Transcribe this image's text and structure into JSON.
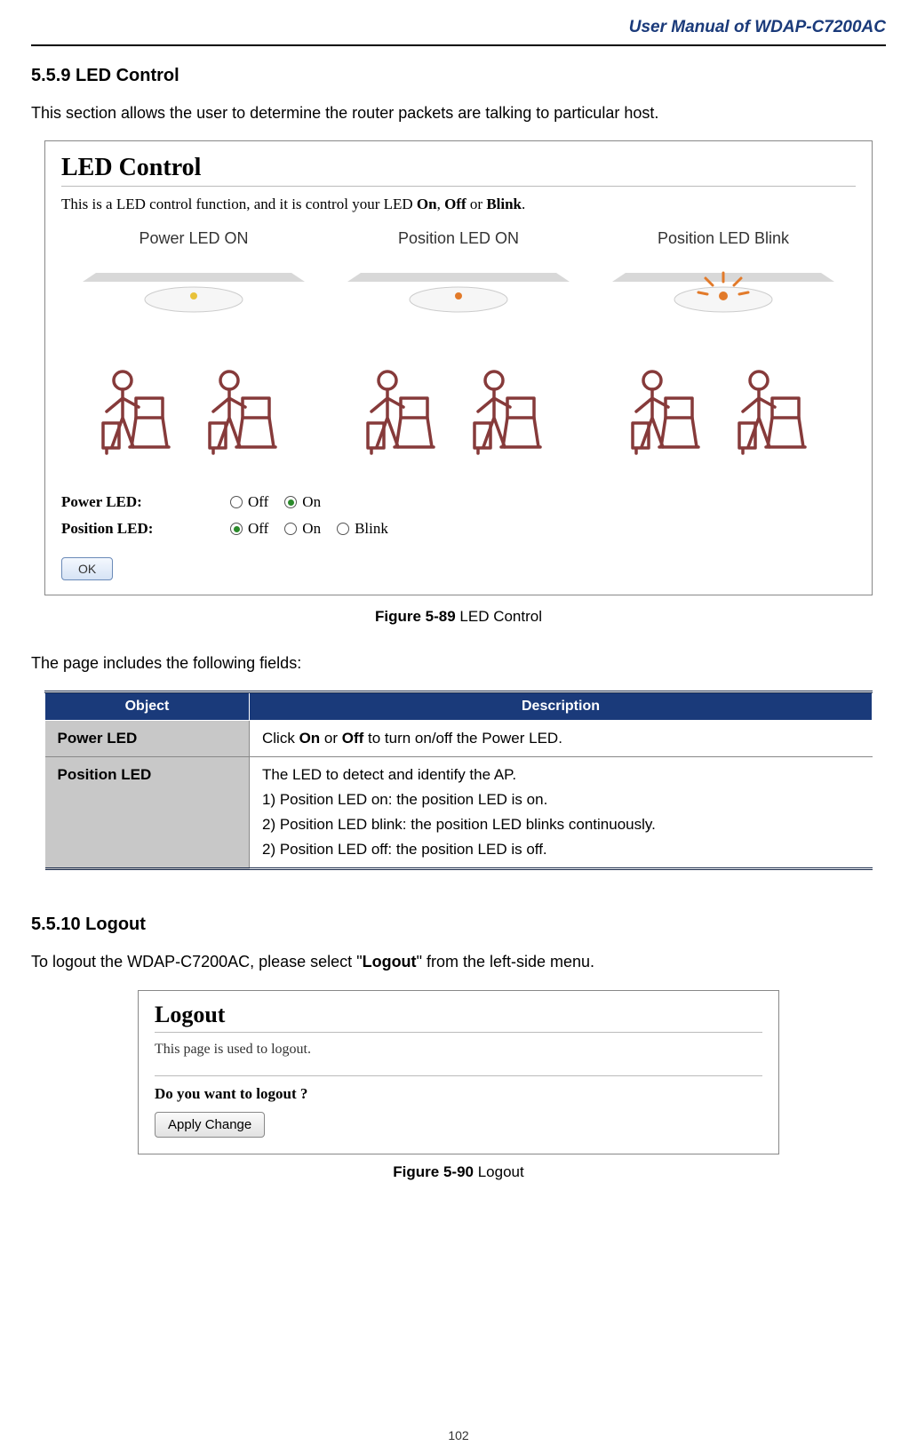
{
  "header": {
    "title": "User Manual of WDAP-C7200AC"
  },
  "section1": {
    "heading": "5.5.9   LED Control",
    "intro": "This section allows the user to determine the router packets are talking to particular host."
  },
  "screenshot1": {
    "title": "LED Control",
    "desc_prefix": "This is a LED control function, and it is control your LED ",
    "desc_on": "On",
    "desc_mid1": ", ",
    "desc_off": "Off",
    "desc_mid2": " or ",
    "desc_blink": "Blink",
    "desc_suffix": ".",
    "col1": "Power LED ON",
    "col2": "Position LED ON",
    "col3": "Position LED Blink",
    "row1_label": "Power LED:",
    "row1_opt1": "Off",
    "row1_opt2": "On",
    "row2_label": "Position LED:",
    "row2_opt1": "Off",
    "row2_opt2": "On",
    "row2_opt3": "Blink",
    "ok": "OK"
  },
  "figure1": {
    "bold": "Figure 5-89",
    "rest": " LED Control"
  },
  "fields_intro": "The page includes the following fields:",
  "table": {
    "h1": "Object",
    "h2": "Description",
    "r1_obj": "Power LED",
    "r1_desc_prefix": "Click ",
    "r1_desc_on": "On",
    "r1_desc_mid": " or ",
    "r1_desc_off": "Off",
    "r1_desc_suffix": " to turn on/off the Power LED.",
    "r2_obj": "Position LED",
    "r2_l1": "The LED to detect and identify the AP.",
    "r2_l2": "1) Position LED on: the position LED is on.",
    "r2_l3": "2) Position LED blink: the position LED blinks continuously.",
    "r2_l4": "2) Position LED off: the position LED is off."
  },
  "section2": {
    "heading": "5.5.10 Logout",
    "intro_prefix": "To logout the WDAP-C7200AC, please select \"",
    "intro_bold": "Logout",
    "intro_suffix": "\" from the left-side menu."
  },
  "screenshot2": {
    "title": "Logout",
    "desc": "This page is used to logout.",
    "q": "Do you want to logout ?",
    "btn": "Apply Change"
  },
  "figure2": {
    "bold": "Figure 5-90",
    "rest": " Logout"
  },
  "page_number": "102"
}
